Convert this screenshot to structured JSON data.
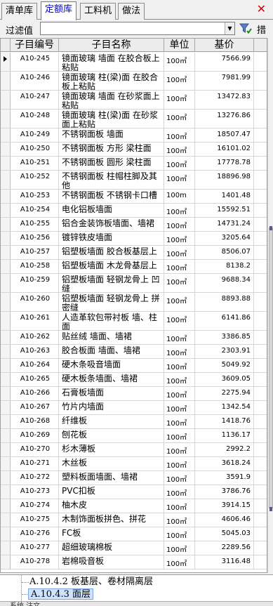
{
  "tabs": [
    {
      "label": "清单库",
      "active": false
    },
    {
      "label": "定额库",
      "active": true
    },
    {
      "label": "工料机",
      "active": false
    },
    {
      "label": "做法",
      "active": false
    }
  ],
  "close_icon": "close-icon",
  "filter": {
    "label": "过滤值",
    "value": "",
    "cut_text": "措"
  },
  "columns": [
    "子目编号",
    "子目名称",
    "单位",
    "基价"
  ],
  "rows": [
    {
      "code": "A10-245",
      "name": "镜面玻璃 墙面 在胶合板上粘贴",
      "unit": "100㎡",
      "price": "7566.99",
      "lines": 2
    },
    {
      "code": "A10-246",
      "name": "镜面玻璃 柱(梁)面 在胶合板上粘贴",
      "unit": "100㎡",
      "price": "7981.99",
      "lines": 2
    },
    {
      "code": "A10-247",
      "name": "镜面玻璃 墙面 在砂浆面上粘贴",
      "unit": "100㎡",
      "price": "13472.83",
      "lines": 2
    },
    {
      "code": "A10-248",
      "name": "镜面玻璃 柱(梁)面 在砂浆面上粘贴",
      "unit": "100㎡",
      "price": "13276.86",
      "lines": 2
    },
    {
      "code": "A10-249",
      "name": "不锈钢面板 墙面",
      "unit": "100㎡",
      "price": "18507.47",
      "lines": 1
    },
    {
      "code": "A10-250",
      "name": "不锈钢面板 方形 梁柱面",
      "unit": "100㎡",
      "price": "16101.02",
      "lines": 1
    },
    {
      "code": "A10-251",
      "name": "不锈钢面板 圆形 梁柱面",
      "unit": "100㎡",
      "price": "17778.78",
      "lines": 1
    },
    {
      "code": "A10-252",
      "name": "不锈钢面板 柱帽柱脚及其他",
      "unit": "100㎡",
      "price": "18896.98",
      "lines": 2
    },
    {
      "code": "A10-253",
      "name": "不锈钢面板 不锈钢卡口槽",
      "unit": "100m",
      "price": "1401.48",
      "lines": 1
    },
    {
      "code": "A10-254",
      "name": "电化铝板墙面",
      "unit": "100㎡",
      "price": "15592.51",
      "lines": 1
    },
    {
      "code": "A10-255",
      "name": "铝合金装饰板墙面、墙裙",
      "unit": "100㎡",
      "price": "14731.24",
      "lines": 1
    },
    {
      "code": "A10-256",
      "name": "镀锌铁皮墙面",
      "unit": "100㎡",
      "price": "3205.64",
      "lines": 1
    },
    {
      "code": "A10-257",
      "name": "铝塑板墙面 胶合板基层上",
      "unit": "100㎡",
      "price": "8506.07",
      "lines": 1
    },
    {
      "code": "A10-258",
      "name": "铝塑板墙面 木龙骨基层上",
      "unit": "100㎡",
      "price": "8138.2",
      "lines": 1
    },
    {
      "code": "A10-259",
      "name": "铝塑板墙面 轻钢龙骨上 凹缝",
      "unit": "100㎡",
      "price": "9688.34",
      "lines": 2
    },
    {
      "code": "A10-260",
      "name": "铝塑板墙面 轻钢龙骨上 拼密缝",
      "unit": "100㎡",
      "price": "8893.88",
      "lines": 2
    },
    {
      "code": "A10-261",
      "name": "人造革软包带衬板 墙、柱面",
      "unit": "100㎡",
      "price": "6141.86",
      "lines": 2
    },
    {
      "code": "A10-262",
      "name": "贴丝绒 墙面、墙裙",
      "unit": "100㎡",
      "price": "3386.85",
      "lines": 1
    },
    {
      "code": "A10-263",
      "name": "胶合板面 墙面、墙裙",
      "unit": "100㎡",
      "price": "2303.91",
      "lines": 1
    },
    {
      "code": "A10-264",
      "name": "硬木条吸音墙面",
      "unit": "100㎡",
      "price": "5049.92",
      "lines": 1
    },
    {
      "code": "A10-265",
      "name": "硬木板条墙面、墙裙",
      "unit": "100㎡",
      "price": "3609.05",
      "lines": 1
    },
    {
      "code": "A10-266",
      "name": "石膏板墙面",
      "unit": "100㎡",
      "price": "2275.94",
      "lines": 1
    },
    {
      "code": "A10-267",
      "name": "竹片内墙面",
      "unit": "100㎡",
      "price": "1342.54",
      "lines": 1
    },
    {
      "code": "A10-268",
      "name": "纤维板",
      "unit": "100㎡",
      "price": "1418.76",
      "lines": 1
    },
    {
      "code": "A10-269",
      "name": "刨花板",
      "unit": "100㎡",
      "price": "1136.17",
      "lines": 1
    },
    {
      "code": "A10-270",
      "name": "杉木薄板",
      "unit": "100㎡",
      "price": "2992.2",
      "lines": 1
    },
    {
      "code": "A10-271",
      "name": "木丝板",
      "unit": "100㎡",
      "price": "3618.24",
      "lines": 1
    },
    {
      "code": "A10-272",
      "name": "塑料板面墙面、墙裙",
      "unit": "100㎡",
      "price": "3591.9",
      "lines": 1
    },
    {
      "code": "A10-273",
      "name": "PVC扣板",
      "unit": "100㎡",
      "price": "3786.76",
      "lines": 1
    },
    {
      "code": "A10-274",
      "name": "柚木皮",
      "unit": "100㎡",
      "price": "3914.15",
      "lines": 1
    },
    {
      "code": "A10-275",
      "name": "木制饰面板拼色、拼花",
      "unit": "100㎡",
      "price": "4606.46",
      "lines": 1
    },
    {
      "code": "A10-276",
      "name": "FC板",
      "unit": "100㎡",
      "price": "5045.03",
      "lines": 1
    },
    {
      "code": "A10-277",
      "name": "超细玻璃棉板",
      "unit": "100㎡",
      "price": "2289.56",
      "lines": 1
    },
    {
      "code": "A10-278",
      "name": "岩棉吸音板",
      "unit": "100㎡",
      "price": "3116.48",
      "lines": 1
    }
  ],
  "tree": {
    "items": [
      {
        "label": "A.10.4.2 板基层、卷材隔离层",
        "selected": false
      },
      {
        "label": "A.10.4.3 面层",
        "selected": true
      }
    ],
    "bottom_text": "系统 注文"
  },
  "colors": {
    "active_tab_text": "#0000cc",
    "close": "#dd0000",
    "selection": "#cfe3ff"
  }
}
